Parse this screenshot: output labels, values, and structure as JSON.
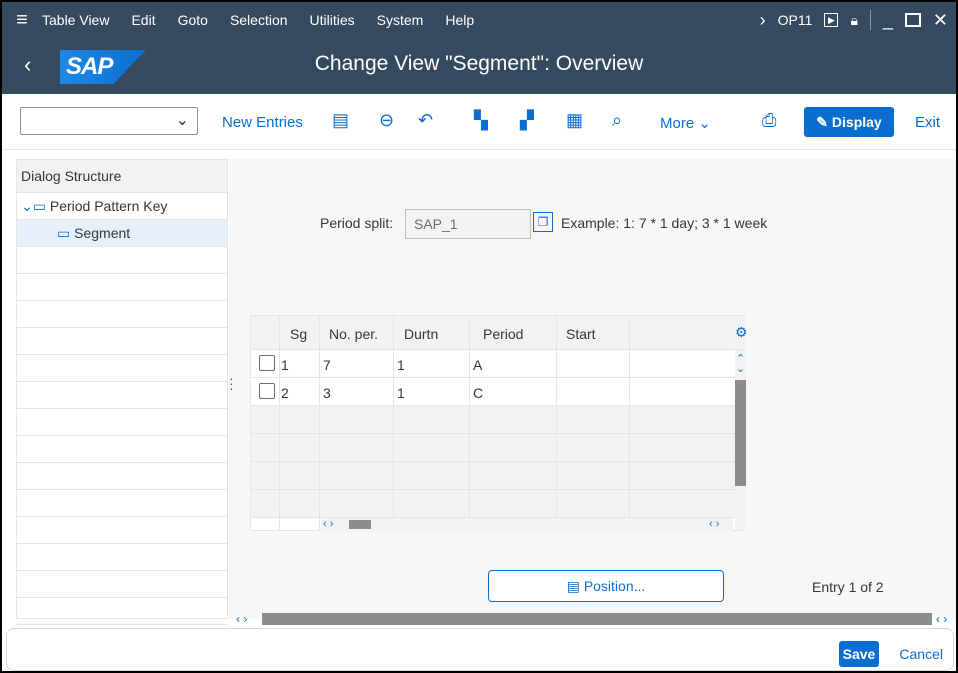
{
  "menubar": {
    "items": [
      "Table View",
      "Edit",
      "Goto",
      "Selection",
      "Utilities",
      "System",
      "Help"
    ],
    "system_id": "OP11"
  },
  "title": "Change View \"Segment\": Overview",
  "logo": "SAP",
  "toolbar": {
    "new_entries": "New Entries",
    "more": "More",
    "display": "Display",
    "exit": "Exit"
  },
  "dialog_structure": {
    "header": "Dialog Structure",
    "items": [
      "Period Pattern Key",
      "Segment"
    ]
  },
  "period_split": {
    "label": "Period split:",
    "value": "SAP_1",
    "example": "Example: 1: 7 * 1 day; 3 * 1 week"
  },
  "table": {
    "columns": [
      "Sg",
      "No. per.",
      "Durtn",
      "Period",
      "Start"
    ],
    "rows": [
      {
        "sg": "1",
        "no_per": "7",
        "durtn": "1",
        "period": "A",
        "start": ""
      },
      {
        "sg": "2",
        "no_per": "3",
        "durtn": "1",
        "period": "C",
        "start": ""
      }
    ]
  },
  "position_button": "Position...",
  "entry_info": "Entry 1 of 2",
  "footer": {
    "save": "Save",
    "cancel": "Cancel"
  },
  "colors": {
    "shell": "#354a5f",
    "accent": "#0a6ed1"
  }
}
